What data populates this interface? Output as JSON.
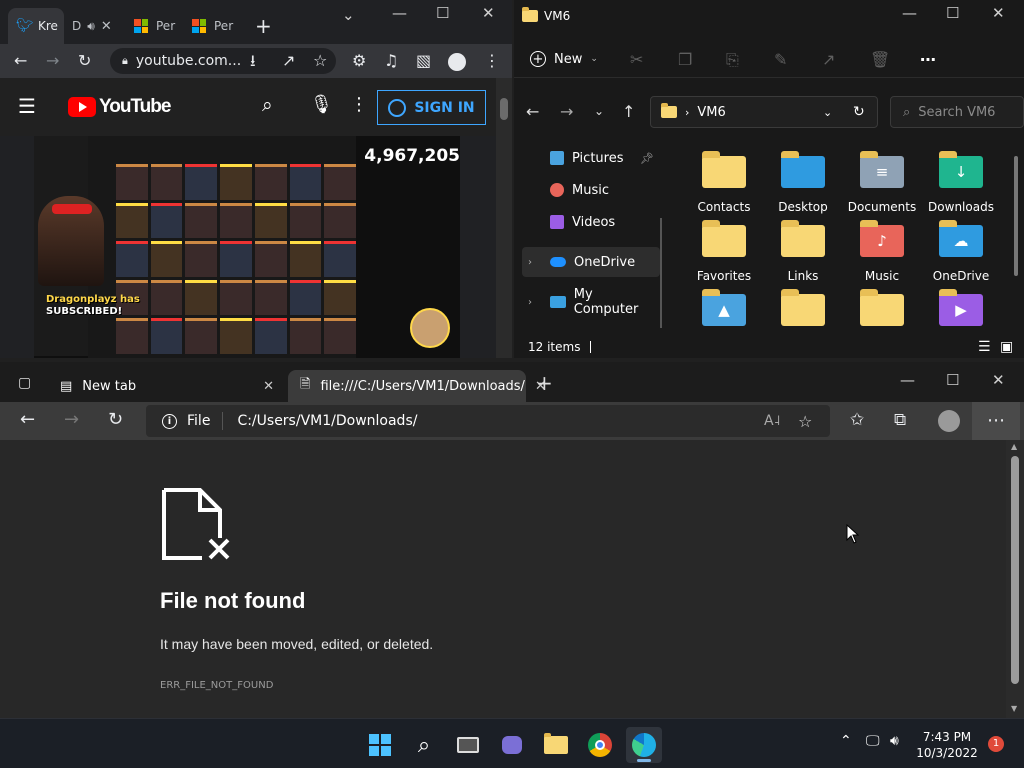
{
  "chrome": {
    "tabs": [
      {
        "label": "Kre",
        "icon": "twitter-icon"
      },
      {
        "label": "D",
        "icon": "audio-icon"
      },
      {
        "label": "Per",
        "icon": "microsoft-icon"
      },
      {
        "label": "Per",
        "icon": "microsoft-icon"
      }
    ],
    "url": "youtube.com...",
    "youtube": {
      "logo_text": "YouTube",
      "signin_label": "SIGN IN"
    },
    "video": {
      "counter": "4,967,205",
      "sub_line1": "Dragonplayz has",
      "sub_line2": "SUBSCRIBED!"
    }
  },
  "explorer": {
    "title": "VM6",
    "new_label": "New",
    "breadcrumb": "VM6",
    "search_placeholder": "Search VM6",
    "sidebar": [
      {
        "label": "Pictures",
        "pinned": true
      },
      {
        "label": "Music"
      },
      {
        "label": "Videos"
      },
      {
        "label": "OneDrive"
      },
      {
        "label": "My Computer"
      }
    ],
    "items": [
      {
        "label": "Contacts"
      },
      {
        "label": "Desktop"
      },
      {
        "label": "Documents"
      },
      {
        "label": "Downloads"
      },
      {
        "label": "Favorites"
      },
      {
        "label": "Links"
      },
      {
        "label": "Music"
      },
      {
        "label": "OneDrive"
      },
      {
        "label": ""
      },
      {
        "label": ""
      },
      {
        "label": ""
      },
      {
        "label": ""
      }
    ],
    "status": "12 items"
  },
  "edge": {
    "tabs": [
      {
        "label": "New tab"
      },
      {
        "label": "file:///C:/Users/VM1/Downloads/"
      }
    ],
    "address_scheme": "File",
    "address": "C:/Users/VM1/Downloads/",
    "error": {
      "title": "File not found",
      "message": "It may have been moved, edited, or deleted.",
      "code": "ERR_FILE_NOT_FOUND"
    }
  },
  "taskbar": {
    "time": "7:43 PM",
    "date": "10/3/2022",
    "notifications": "1"
  },
  "colors": {
    "accent_blue": "#3ea6ff",
    "youtube_red": "#ff0000",
    "folder_yellow": "#f8d775"
  }
}
